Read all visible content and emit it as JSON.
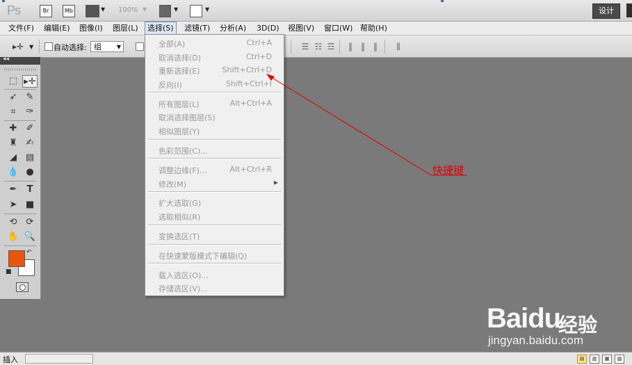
{
  "app": {
    "logo": "Ps",
    "bar_buttons": [
      "Br",
      "Mb"
    ],
    "zoom": "100%",
    "workspace_label": "设计",
    "colors": {
      "foreground": "#e8560b",
      "background": "#ffffff",
      "annotation": "#e00000"
    }
  },
  "menubar": {
    "items": [
      "文件(F)",
      "编辑(E)",
      "图像(I)",
      "图层(L)",
      "选择(S)",
      "滤镜(T)",
      "分析(A)",
      "3D(D)",
      "视图(V)",
      "窗口(W)",
      "帮助(H)"
    ],
    "active": "选择(S)"
  },
  "options": {
    "auto_select_label": "自动选择:",
    "auto_select_value": "组"
  },
  "select_menu": {
    "groups": [
      [
        {
          "label": "全部(A)",
          "shortcut": "Ctrl+A"
        },
        {
          "label": "取消选择(D)",
          "shortcut": "Ctrl+D"
        },
        {
          "label": "重新选择(E)",
          "shortcut": "Shift+Ctrl+D"
        },
        {
          "label": "反向(I)",
          "shortcut": "Shift+Ctrl+I"
        }
      ],
      [
        {
          "label": "所有图层(L)",
          "shortcut": "Alt+Ctrl+A"
        },
        {
          "label": "取消选择图层(S)",
          "shortcut": ""
        },
        {
          "label": "相似图层(Y)",
          "shortcut": ""
        }
      ],
      [
        {
          "label": "色彩范围(C)...",
          "shortcut": ""
        }
      ],
      [
        {
          "label": "调整边缘(F)...",
          "shortcut": "Alt+Ctrl+R"
        },
        {
          "label": "修改(M)",
          "shortcut": "",
          "submenu": true
        }
      ],
      [
        {
          "label": "扩大选取(G)",
          "shortcut": ""
        },
        {
          "label": "选取相似(R)",
          "shortcut": ""
        }
      ],
      [
        {
          "label": "变换选区(T)",
          "shortcut": ""
        }
      ],
      [
        {
          "label": "在快速蒙版模式下编辑(Q)",
          "shortcut": ""
        }
      ],
      [
        {
          "label": "载入选区(O)...",
          "shortcut": ""
        },
        {
          "label": "存储选区(V)...",
          "shortcut": ""
        }
      ]
    ]
  },
  "annotation": {
    "text": "快捷键"
  },
  "watermark": {
    "logo": "Baidu",
    "cn": "经验",
    "url": "jingyan.baidu.com"
  },
  "status": {
    "text": "插入"
  }
}
